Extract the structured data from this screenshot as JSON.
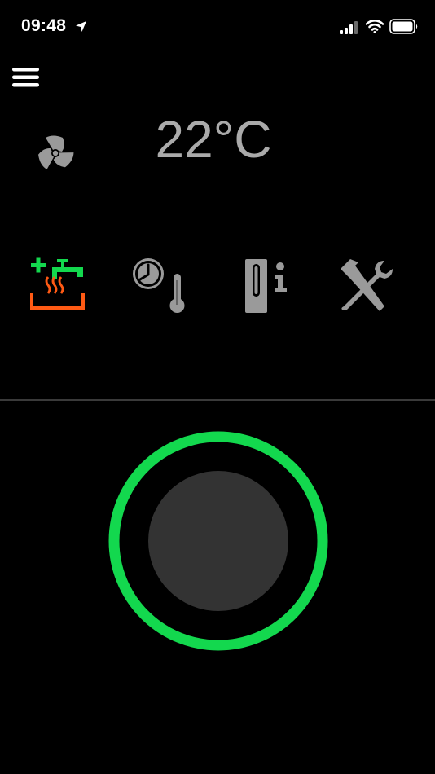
{
  "status_bar": {
    "time": "09:48",
    "icons": [
      "location-arrow-icon",
      "cellular-signal-icon",
      "wifi-icon",
      "battery-icon"
    ]
  },
  "header": {
    "menu_icon": "hamburger-menu-icon",
    "fan_icon": "fan-icon",
    "temperature": "22°C"
  },
  "modes": [
    {
      "name": "hot-water",
      "icon": "hot-water-tap-icon",
      "active": true
    },
    {
      "name": "schedule-temperature",
      "icon": "clock-thermometer-icon",
      "active": false
    },
    {
      "name": "device-info",
      "icon": "device-info-icon",
      "active": false
    },
    {
      "name": "settings-tools",
      "icon": "hammer-wrench-icon",
      "active": false
    }
  ],
  "power": {
    "icon": "power-ring-icon",
    "state": "on"
  },
  "colors": {
    "background": "#000000",
    "text_gray": "#aaaaaa",
    "icon_gray": "#9a9a9a",
    "accent_green": "#13d84e",
    "accent_orange": "#ff5a14",
    "knob": "#333333",
    "divider": "#3a3a3a"
  }
}
